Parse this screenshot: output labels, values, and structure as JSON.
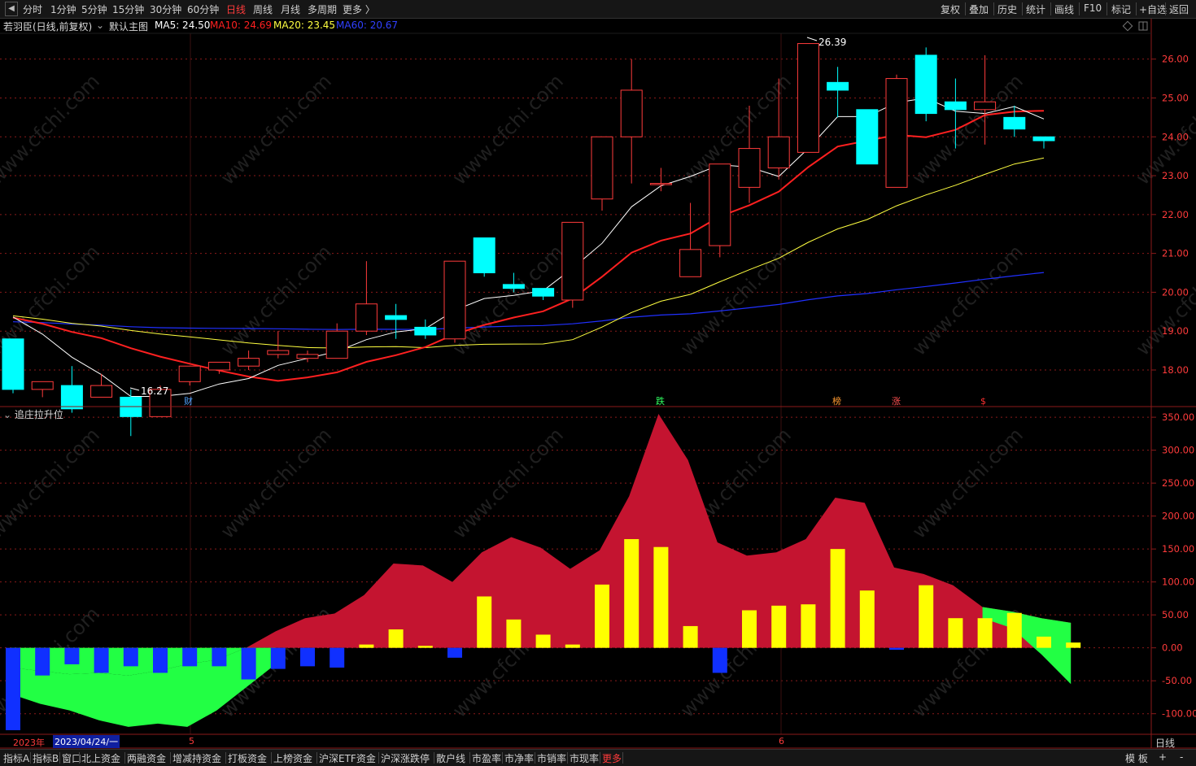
{
  "top_bar": {
    "left_tabs": [
      "分时",
      "1分钟",
      "5分钟",
      "15分钟",
      "30分钟",
      "60分钟",
      "日线",
      "周线",
      "月线",
      "多周期",
      "更多 〉"
    ],
    "active_tab": "日线",
    "right_tools": [
      "复权",
      "叠加",
      "历史",
      "统计",
      "画线",
      "F10",
      "标记",
      "+自选",
      "返回"
    ]
  },
  "info_bar": {
    "stock": "若羽臣(日线,前复权)",
    "main_chart_name": "默认主图",
    "ma5": "MA5: 24.50",
    "ma10": "MA10: 24.69",
    "ma20": "MA20: 23.45",
    "ma60": "MA60: 20.67",
    "colors": {
      "ma5": "#ffffff",
      "ma10": "#ff2020",
      "ma20": "#ffff40",
      "ma60": "#2030ff"
    }
  },
  "price_axis": [
    "26.00",
    "25.00",
    "24.00",
    "23.00",
    "22.00",
    "21.00",
    "20.00",
    "19.00",
    "18.00"
  ],
  "annotations": {
    "high": "26.39",
    "low": "16.27"
  },
  "event_markers": [
    {
      "label": "财",
      "color": "#4fa3ff"
    },
    {
      "label": "跌",
      "color": "#30ff60"
    },
    {
      "label": "榜",
      "color": "#ff9a30"
    },
    {
      "label": "涨",
      "color": "#ff5050"
    },
    {
      "label": "$",
      "color": "#ff3030"
    }
  ],
  "sub_chart": {
    "title": "追庄拉升位",
    "axis": [
      "350.00",
      "300.00",
      "250.00",
      "200.00",
      "150.00",
      "100.00",
      "50.00",
      "0.00",
      "-50.00",
      "-100.00"
    ]
  },
  "date_axis": {
    "year": "2023年",
    "cursor_date": "2023/04/24/一",
    "month_5": "5",
    "month_6": "6"
  },
  "period_label": "日线",
  "bottom_bar": {
    "tabs": [
      "指标A",
      "指标B",
      "窗口",
      "北上资金",
      "两融资金",
      "增减持资金",
      "打板资金",
      "上榜资金",
      "沪深ETF资金",
      "沪深涨跌停",
      "散户线",
      "市盈率",
      "市净率",
      "市销率",
      "市现率",
      "更多"
    ],
    "active_tab": "更多",
    "right": [
      "模 板",
      "+",
      "-"
    ]
  },
  "watermark": "www.cfchi.com",
  "chart_data": [
    {
      "type": "candlestick",
      "title": "若羽臣(日线,前复权)",
      "ylim": [
        17.1,
        26.6
      ],
      "candles": [
        {
          "o": 18.8,
          "h": 18.8,
          "l": 17.4,
          "c": 17.5
        },
        {
          "o": 17.5,
          "h": 17.7,
          "l": 17.3,
          "c": 17.7
        },
        {
          "o": 17.6,
          "h": 18.1,
          "l": 16.9,
          "c": 17.0
        },
        {
          "o": 17.3,
          "h": 17.9,
          "l": 17.3,
          "c": 17.6
        },
        {
          "o": 17.3,
          "h": 17.5,
          "l": 16.3,
          "c": 16.8
        },
        {
          "o": 16.8,
          "h": 17.6,
          "l": 16.8,
          "c": 17.5
        },
        {
          "o": 17.7,
          "h": 18.1,
          "l": 17.6,
          "c": 18.1
        },
        {
          "o": 18.0,
          "h": 18.2,
          "l": 17.9,
          "c": 18.2
        },
        {
          "o": 18.1,
          "h": 18.5,
          "l": 18.0,
          "c": 18.3
        },
        {
          "o": 18.4,
          "h": 19.0,
          "l": 18.3,
          "c": 18.5
        },
        {
          "o": 18.3,
          "h": 18.5,
          "l": 18.2,
          "c": 18.4
        },
        {
          "o": 18.3,
          "h": 19.2,
          "l": 18.3,
          "c": 19.0
        },
        {
          "o": 19.0,
          "h": 20.8,
          "l": 18.9,
          "c": 19.7
        },
        {
          "o": 19.4,
          "h": 19.7,
          "l": 18.8,
          "c": 19.3
        },
        {
          "o": 19.1,
          "h": 19.3,
          "l": 18.8,
          "c": 18.9
        },
        {
          "o": 18.8,
          "h": 20.8,
          "l": 18.7,
          "c": 20.8
        },
        {
          "o": 21.4,
          "h": 21.4,
          "l": 20.4,
          "c": 20.5
        },
        {
          "o": 20.2,
          "h": 20.5,
          "l": 20.0,
          "c": 20.1
        },
        {
          "o": 20.1,
          "h": 20.1,
          "l": 19.8,
          "c": 19.9
        },
        {
          "o": 19.8,
          "h": 21.8,
          "l": 19.6,
          "c": 21.8
        },
        {
          "o": 22.4,
          "h": 24.0,
          "l": 22.1,
          "c": 24.0
        },
        {
          "o": 24.0,
          "h": 26.0,
          "l": 22.8,
          "c": 25.2
        },
        {
          "o": 22.8,
          "h": 23.2,
          "l": 22.6,
          "c": 22.8
        },
        {
          "o": 20.4,
          "h": 22.3,
          "l": 20.4,
          "c": 21.1
        },
        {
          "o": 21.2,
          "h": 23.3,
          "l": 20.9,
          "c": 23.3
        },
        {
          "o": 22.7,
          "h": 24.8,
          "l": 22.3,
          "c": 23.7
        },
        {
          "o": 23.2,
          "h": 25.5,
          "l": 22.9,
          "c": 24.0
        },
        {
          "o": 23.6,
          "h": 26.39,
          "l": 23.6,
          "c": 26.4
        },
        {
          "o": 25.4,
          "h": 25.8,
          "l": 24.5,
          "c": 25.2
        },
        {
          "o": 24.7,
          "h": 24.7,
          "l": 23.3,
          "c": 23.3
        },
        {
          "o": 22.7,
          "h": 25.6,
          "l": 22.7,
          "c": 25.5
        },
        {
          "o": 26.1,
          "h": 26.3,
          "l": 24.4,
          "c": 24.6
        },
        {
          "o": 24.9,
          "h": 25.5,
          "l": 23.7,
          "c": 24.7
        },
        {
          "o": 24.7,
          "h": 26.1,
          "l": 23.8,
          "c": 24.9
        },
        {
          "o": 24.5,
          "h": 24.8,
          "l": 24.0,
          "c": 24.2
        },
        {
          "o": 24.0,
          "h": 24.0,
          "l": 23.7,
          "c": 23.9
        }
      ]
    },
    {
      "type": "area",
      "title": "追庄拉升位",
      "ylim": [
        -130,
        360
      ],
      "series": [
        {
          "values": [
            -30,
            -35,
            -40,
            -38,
            -42,
            -35,
            -25,
            -18,
            0,
            25,
            45,
            52,
            80,
            128,
            125,
            100,
            145,
            168,
            152,
            120,
            148,
            230,
            355,
            285,
            160,
            140,
            145,
            165,
            228,
            220,
            122,
            112,
            95,
            62,
            55,
            45,
            38
          ]
        },
        {
          "values": [
            -125,
            -42,
            -25,
            -38,
            -28,
            -38,
            -28,
            -28,
            -48,
            -32,
            -28,
            -30,
            5,
            28,
            3,
            -15,
            78,
            43,
            20,
            5,
            96,
            165,
            153,
            33,
            -38,
            57,
            64,
            66,
            150,
            87,
            -3,
            95,
            45,
            45,
            53,
            17,
            8
          ]
        }
      ]
    }
  ]
}
